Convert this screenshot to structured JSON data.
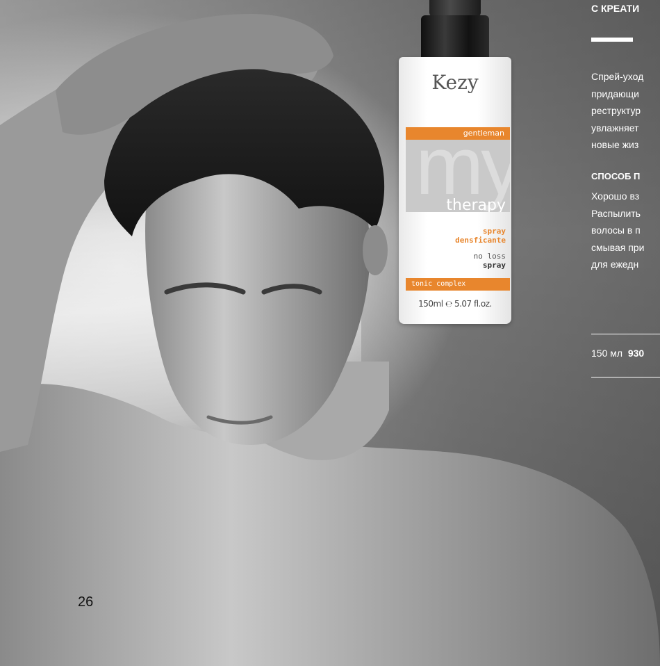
{
  "header": {
    "title_partial": "С КРЕАТИ"
  },
  "description": {
    "lines": [
      "Спрей-уход",
      "придающи",
      "реструктур",
      "увлажняет",
      "новые жиз"
    ]
  },
  "usage": {
    "title_partial": "СПОСОБ П",
    "lines": [
      "Хорошо вз",
      "Распылить",
      "волосы в п",
      "смывая при",
      "для ежедн"
    ]
  },
  "price": {
    "volume": "150 мл",
    "amount_partial": "930"
  },
  "page": {
    "number": "26"
  },
  "product": {
    "brand": "Kezy",
    "line": "gentleman",
    "logo_word": "my",
    "logo_word2": "therapy",
    "spray_line1": "spray",
    "spray_line2": "densficante",
    "claim_line1": "no loss",
    "claim_line2": "spray",
    "complex": "tonic complex",
    "volume": "150ml ℮ 5.07 fl.oz."
  },
  "colors": {
    "accent": "#e8862d",
    "text_light": "#ffffff"
  }
}
